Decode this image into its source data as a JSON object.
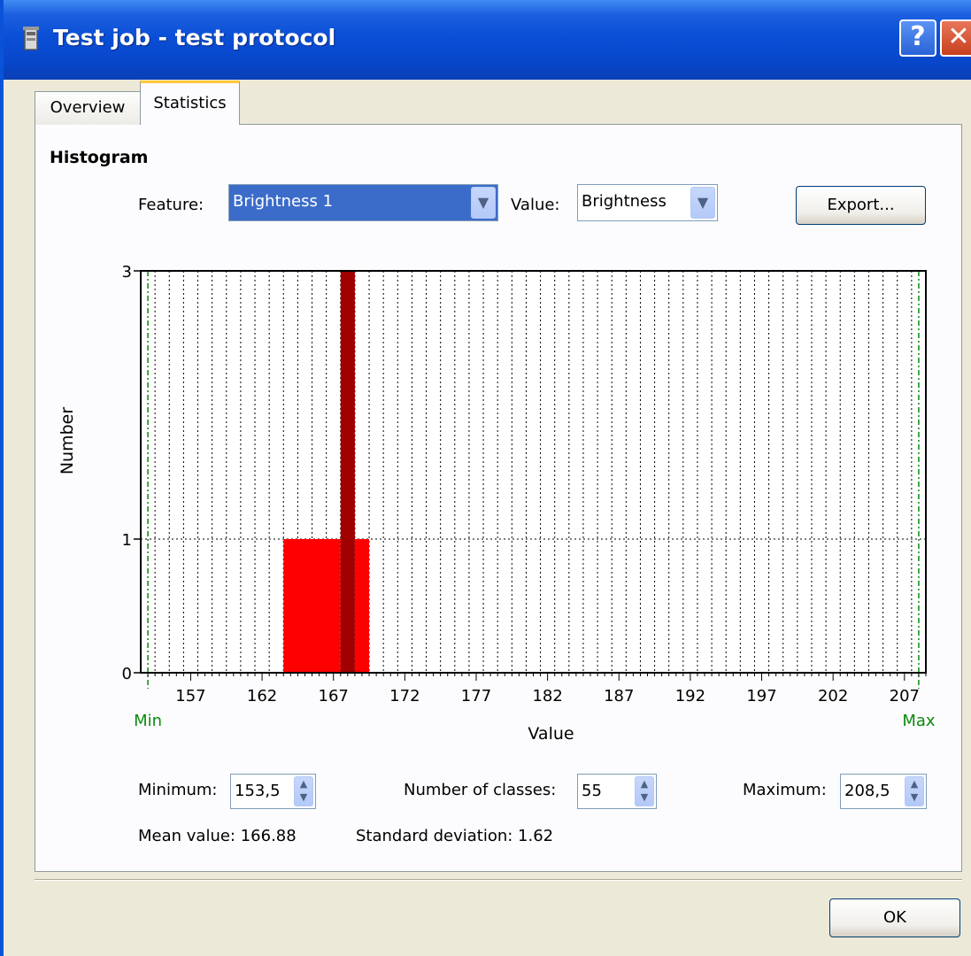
{
  "window": {
    "title": "Test job - test protocol",
    "help_label": "?",
    "close_label": "✕"
  },
  "tabs": [
    {
      "label": "Overview",
      "active": false
    },
    {
      "label": "Statistics",
      "active": true
    }
  ],
  "histogram": {
    "heading": "Histogram",
    "feature_label": "Feature:",
    "feature_value": "Brightness 1",
    "value_label": "Value:",
    "value_value": "Brightness",
    "export_label": "Export..."
  },
  "chart_data": {
    "type": "bar",
    "xlabel": "Value",
    "ylabel": "Number",
    "xlim": [
      153.5,
      208.5
    ],
    "ylim": [
      0,
      3
    ],
    "x_ticks": [
      157,
      162,
      167,
      172,
      177,
      182,
      187,
      192,
      197,
      202,
      207
    ],
    "y_ticks": [
      0,
      1,
      3
    ],
    "y_scale": "nonlinear",
    "grid": true,
    "bin_width": 1,
    "bars": [
      {
        "x0": 163.5,
        "x1": 167.5,
        "value": 1,
        "color": "#ff0000"
      },
      {
        "x0": 167.5,
        "x1": 168.5,
        "value": 3,
        "color": "#a00000"
      },
      {
        "x0": 168.5,
        "x1": 169.5,
        "value": 1,
        "color": "#ff0000"
      }
    ],
    "markers": [
      {
        "label": "Min",
        "x": 154,
        "color": "#0a8a0a"
      },
      {
        "label": "Max",
        "x": 208,
        "color": "#0a8a0a"
      }
    ]
  },
  "controls": {
    "minimum_label": "Minimum:",
    "minimum_value": "153,5",
    "classes_label": "Number of classes:",
    "classes_value": "55",
    "maximum_label": "Maximum:",
    "maximum_value": "208,5"
  },
  "stats": {
    "mean": "Mean value: 166.88",
    "stddev": "Standard deviation: 1.62"
  },
  "ok_label": "OK"
}
